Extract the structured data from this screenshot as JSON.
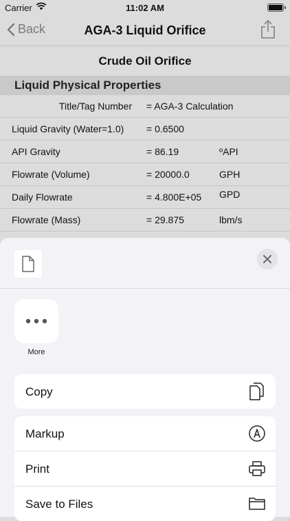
{
  "status": {
    "carrier": "Carrier",
    "time": "11:02 AM"
  },
  "nav": {
    "back_label": "Back",
    "title": "AGA-3 Liquid Orifice"
  },
  "document": {
    "title": "Crude Oil Orifice",
    "section": "Liquid Physical Properties",
    "rows": [
      {
        "label": "Title/Tag Number",
        "value": "= AGA-3 Calculation",
        "unit": ""
      },
      {
        "label": "Liquid Gravity (Water=1.0)",
        "value": "= 0.6500",
        "unit": ""
      },
      {
        "label": "API Gravity",
        "value": "= 86.19",
        "unit": "ºAPI"
      },
      {
        "label": "Flowrate (Volume)",
        "value": "= 20000.0",
        "unit": "GPH"
      },
      {
        "label": "Daily Flowrate",
        "value": "= 4.800E+05",
        "unit": "GPD"
      },
      {
        "label": "Flowrate (Mass)",
        "value": "= 29.875",
        "unit": "lbm/s"
      }
    ]
  },
  "share_sheet": {
    "more_label": "More",
    "actions_group1": [
      {
        "label": "Copy",
        "icon": "copy-icon"
      }
    ],
    "actions_group2": [
      {
        "label": "Markup",
        "icon": "markup-icon"
      },
      {
        "label": "Print",
        "icon": "printer-icon"
      },
      {
        "label": "Save to Files",
        "icon": "folder-icon"
      }
    ]
  }
}
